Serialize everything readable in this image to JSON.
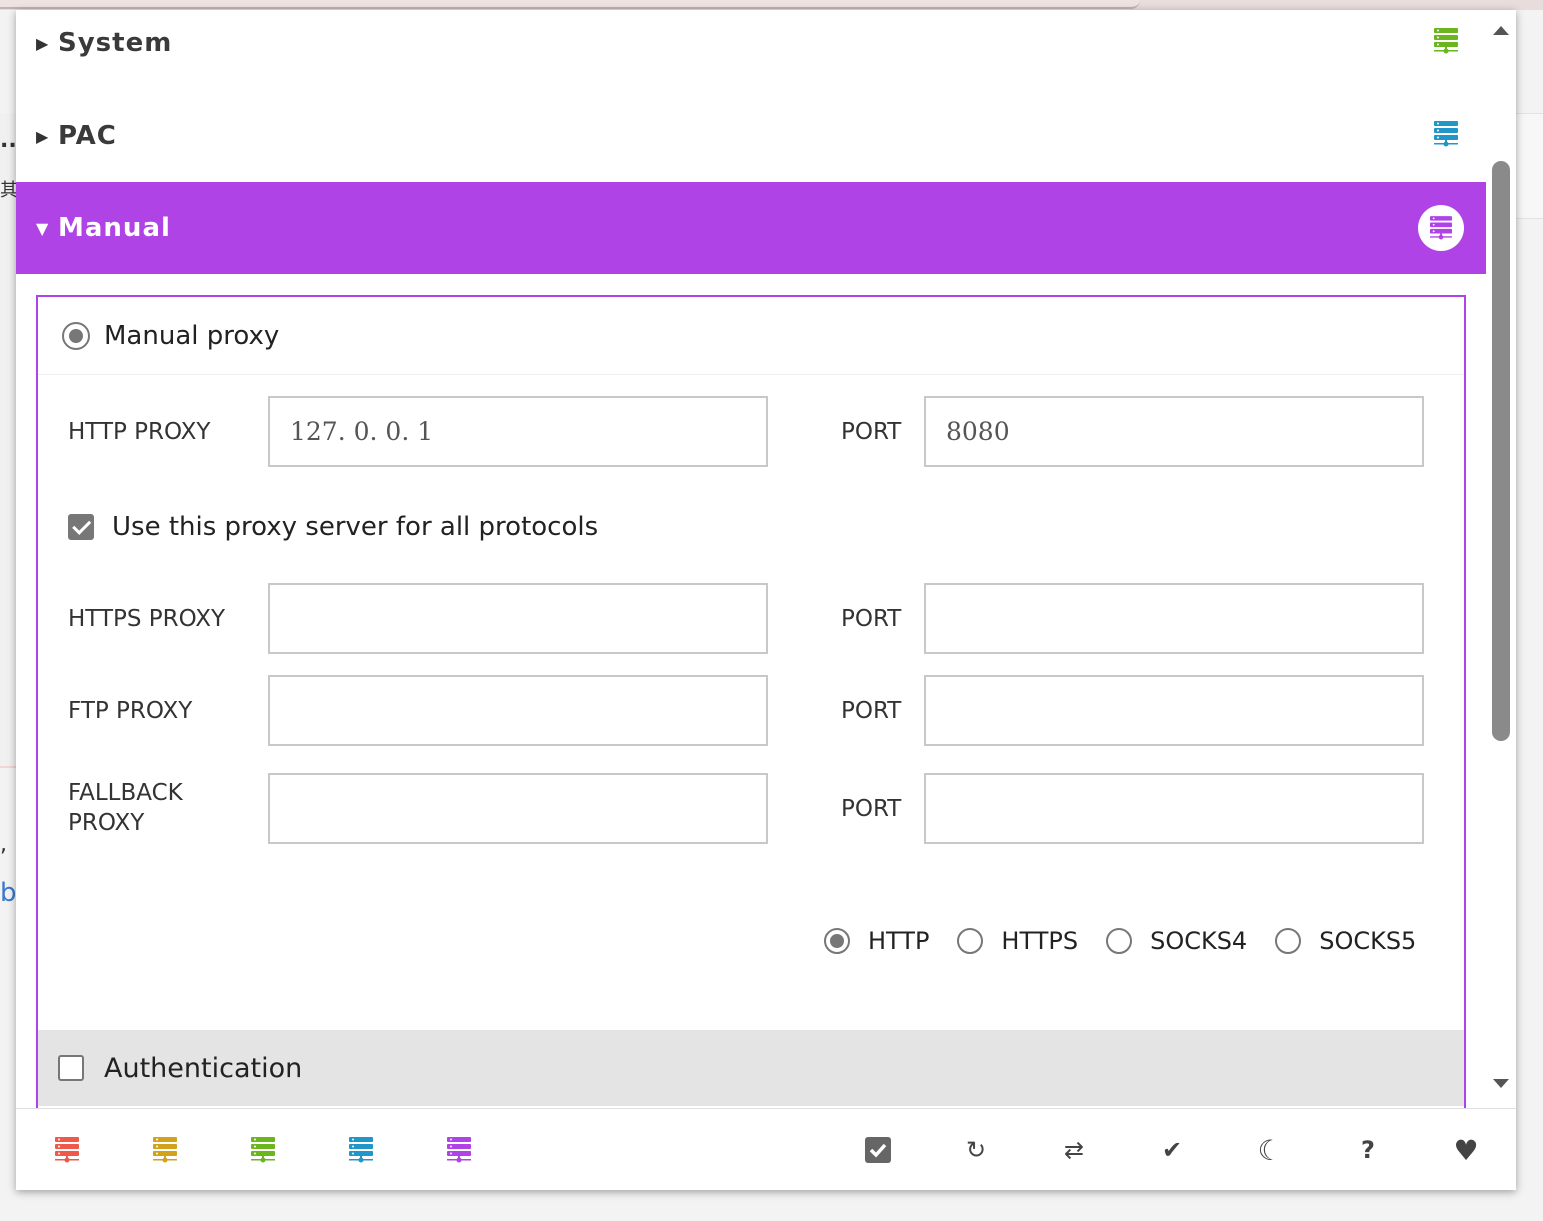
{
  "sections": {
    "system": {
      "label": "System",
      "expand_glyph": "▶",
      "icon": "server-icon",
      "icon_color": "#6bb51f"
    },
    "pac": {
      "label": "PAC",
      "expand_glyph": "▶",
      "icon": "server-icon",
      "icon_color": "#2196c9"
    },
    "manual": {
      "label": "Manual",
      "expand_glyph": "▼",
      "icon": "server-icon",
      "icon_color": "#b043e6",
      "accent": "#b043e6"
    }
  },
  "manual": {
    "mode_label": "Manual proxy",
    "http": {
      "label": "HTTP PROXY",
      "value": "127. 0. 0. 1",
      "port_label": "PORT",
      "port_value": "8080"
    },
    "use_all_label": "Use this proxy server for all protocols",
    "use_all_checked": true,
    "https": {
      "label": "HTTPS PROXY",
      "value": "",
      "port_label": "PORT",
      "port_value": ""
    },
    "ftp": {
      "label": "FTP PROXY",
      "value": "",
      "port_label": "PORT",
      "port_value": ""
    },
    "fallback": {
      "label": "FALLBACK PROXY",
      "value": "",
      "port_label": "PORT",
      "port_value": ""
    },
    "protocols": [
      {
        "label": "HTTP",
        "checked": true
      },
      {
        "label": "HTTPS",
        "checked": false
      },
      {
        "label": "SOCKS4",
        "checked": false
      },
      {
        "label": "SOCKS5",
        "checked": false
      }
    ],
    "auth_label": "Authentication",
    "auth_checked": false
  },
  "footer": {
    "proxy_icons": [
      {
        "name": "server-icon",
        "color": "#f0584a"
      },
      {
        "name": "server-icon",
        "color": "#d1a21a"
      },
      {
        "name": "server-icon",
        "color": "#6bb51f"
      },
      {
        "name": "server-icon",
        "color": "#2196c9"
      },
      {
        "name": "server-icon",
        "color": "#b043e6"
      }
    ],
    "actions": [
      {
        "name": "checkbox-icon",
        "glyph": "☑"
      },
      {
        "name": "refresh-icon",
        "glyph": "↻"
      },
      {
        "name": "repeat-icon",
        "glyph": "⇄"
      },
      {
        "name": "check-icon",
        "glyph": "✔"
      },
      {
        "name": "moon-icon",
        "glyph": "☾"
      },
      {
        "name": "help-icon",
        "glyph": "?"
      },
      {
        "name": "heart-icon",
        "glyph": "♥"
      }
    ]
  },
  "background": {
    "left_glyphs": [
      "..",
      "其",
      ",",
      "b"
    ]
  }
}
